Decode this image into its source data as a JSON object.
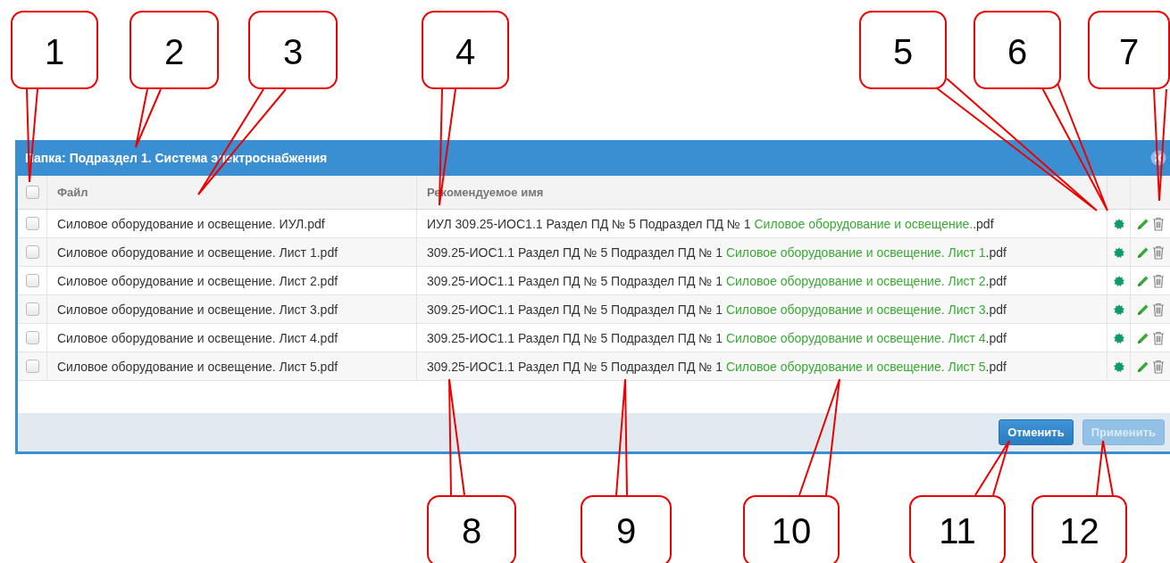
{
  "dialog": {
    "title": "Папка: Подраздел 1. Система электроснабжения"
  },
  "table": {
    "select_all": {
      "checked": false
    },
    "columns": [
      "Файл",
      "Рекомендуемое имя"
    ],
    "rows": [
      {
        "checked": false,
        "file": "Силовое оборудование и освещение. ИУЛ.pdf",
        "name": [
          {
            "kind": "plain",
            "text": "ИУЛ 309.25-ИОС1.1 Раздел ПД № 5 Подраздел ПД № 1 "
          },
          {
            "kind": "highlight",
            "text": "Силовое оборудование и освещение."
          },
          {
            "kind": "plain",
            "text": ".pdf"
          }
        ],
        "status": true
      },
      {
        "checked": false,
        "file": "Силовое оборудование и освещение. Лист 1.pdf",
        "name": [
          {
            "kind": "plain",
            "text": "309.25-ИОС1.1 Раздел ПД № 5 Подраздел ПД № 1 "
          },
          {
            "kind": "highlight",
            "text": "Силовое оборудование и освещение. Лист 1"
          },
          {
            "kind": "plain",
            "text": ".pdf"
          }
        ],
        "status": true
      },
      {
        "checked": false,
        "file": "Силовое оборудование и освещение. Лист 2.pdf",
        "name": [
          {
            "kind": "plain",
            "text": "309.25-ИОС1.1 Раздел ПД № 5 Подраздел ПД № 1 "
          },
          {
            "kind": "highlight",
            "text": "Силовое оборудование и освещение. Лист 2"
          },
          {
            "kind": "plain",
            "text": ".pdf"
          }
        ],
        "status": true
      },
      {
        "checked": false,
        "file": "Силовое оборудование и освещение. Лист 3.pdf",
        "name": [
          {
            "kind": "plain",
            "text": "309.25-ИОС1.1 Раздел ПД № 5 Подраздел ПД № 1 "
          },
          {
            "kind": "highlight",
            "text": "Силовое оборудование и освещение. Лист 3"
          },
          {
            "kind": "plain",
            "text": ".pdf"
          }
        ],
        "status": true
      },
      {
        "checked": false,
        "file": "Силовое оборудование и освещение. Лист 4.pdf",
        "name": [
          {
            "kind": "plain",
            "text": "309.25-ИОС1.1 Раздел ПД № 5 Подраздел ПД № 1 "
          },
          {
            "kind": "highlight",
            "text": "Силовое оборудование и освещение. Лист 4"
          },
          {
            "kind": "plain",
            "text": ".pdf"
          }
        ],
        "status": true
      },
      {
        "checked": false,
        "file": "Силовое оборудование и освещение. Лист 5.pdf",
        "name": [
          {
            "kind": "plain",
            "text": "309.25-ИОС1.1 Раздел ПД № 5 Подраздел ПД № 1 "
          },
          {
            "kind": "highlight",
            "text": "Силовое оборудование и освещение. Лист 5"
          },
          {
            "kind": "plain",
            "text": ".pdf"
          }
        ],
        "status": true
      }
    ]
  },
  "buttons": [
    {
      "label": "Отменить",
      "disabled": false
    },
    {
      "label": "Применить",
      "disabled": true
    }
  ],
  "callouts": [
    {
      "label": "1"
    },
    {
      "label": "2"
    },
    {
      "label": "3"
    },
    {
      "label": "4"
    },
    {
      "label": "5"
    },
    {
      "label": "6"
    },
    {
      "label": "7"
    },
    {
      "label": "8"
    },
    {
      "label": "9"
    },
    {
      "label": "10"
    },
    {
      "label": "11"
    },
    {
      "label": "12"
    }
  ]
}
